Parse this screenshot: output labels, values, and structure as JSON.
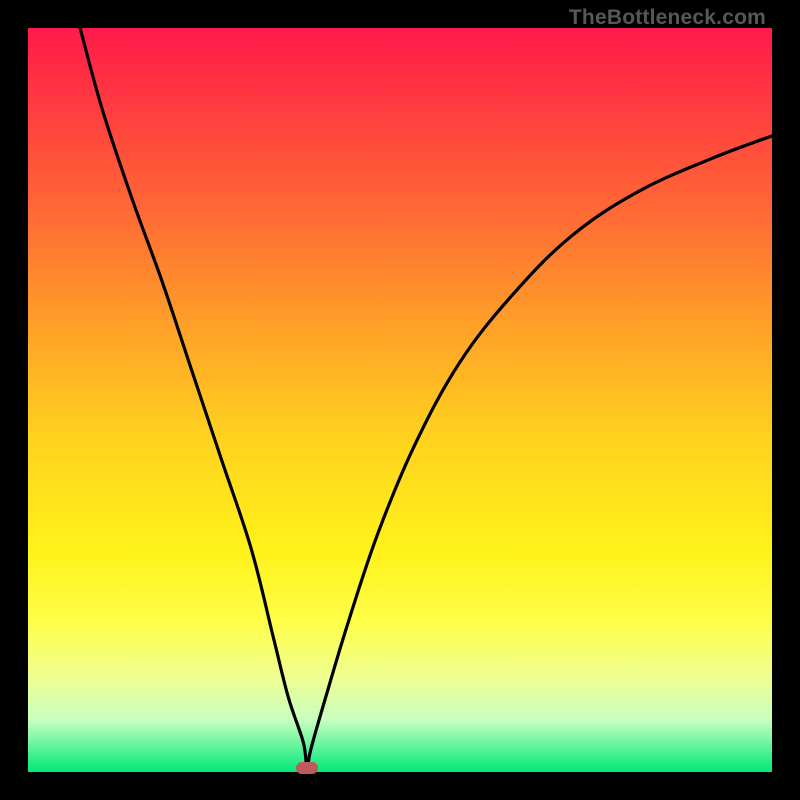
{
  "watermark": "TheBottleneck.com",
  "chart_data": {
    "type": "line",
    "title": "",
    "xlabel": "",
    "ylabel": "",
    "xlim": [
      0,
      100
    ],
    "ylim": [
      0,
      100
    ],
    "background_gradient": {
      "top": "#ff1a4b",
      "bottom": "#00e878",
      "meaning": "red=high bottleneck, green=low bottleneck"
    },
    "series": [
      {
        "name": "bottleneck-curve",
        "x": [
          7,
          10,
          14,
          18,
          22,
          26,
          30,
          33,
          35,
          37,
          37.5,
          38,
          40,
          43,
          47,
          52,
          58,
          65,
          73,
          82,
          92,
          100
        ],
        "values": [
          100,
          89,
          77,
          66,
          54,
          42,
          30,
          18,
          10,
          4,
          0.5,
          3,
          10,
          20,
          32,
          44,
          55,
          64,
          72,
          78,
          82.5,
          85.5
        ]
      }
    ],
    "marker": {
      "name": "optimal-point",
      "x": 37.5,
      "y": 0.5,
      "color": "#c05a5a"
    }
  }
}
